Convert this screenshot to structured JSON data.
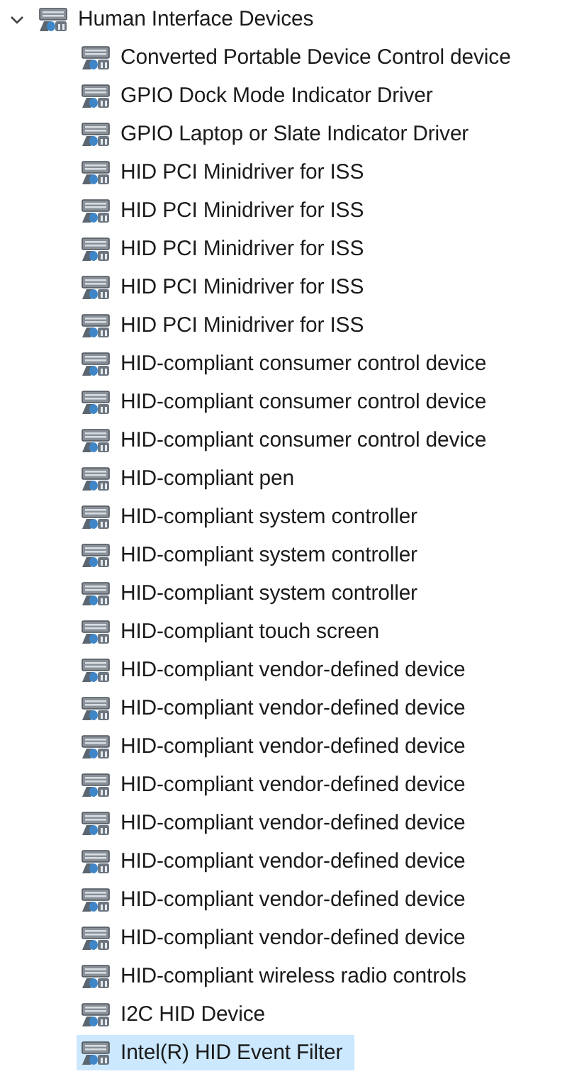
{
  "tree": {
    "label": "Human Interface Devices",
    "expanded": true,
    "children": [
      {
        "label": "Converted Portable Device Control device",
        "selected": false
      },
      {
        "label": "GPIO Dock Mode Indicator Driver",
        "selected": false
      },
      {
        "label": "GPIO Laptop or Slate Indicator Driver",
        "selected": false
      },
      {
        "label": "HID PCI Minidriver for ISS",
        "selected": false
      },
      {
        "label": "HID PCI Minidriver for ISS",
        "selected": false
      },
      {
        "label": "HID PCI Minidriver for ISS",
        "selected": false
      },
      {
        "label": "HID PCI Minidriver for ISS",
        "selected": false
      },
      {
        "label": "HID PCI Minidriver for ISS",
        "selected": false
      },
      {
        "label": "HID-compliant consumer control device",
        "selected": false
      },
      {
        "label": "HID-compliant consumer control device",
        "selected": false
      },
      {
        "label": "HID-compliant consumer control device",
        "selected": false
      },
      {
        "label": "HID-compliant pen",
        "selected": false
      },
      {
        "label": "HID-compliant system controller",
        "selected": false
      },
      {
        "label": "HID-compliant system controller",
        "selected": false
      },
      {
        "label": "HID-compliant system controller",
        "selected": false
      },
      {
        "label": "HID-compliant touch screen",
        "selected": false
      },
      {
        "label": "HID-compliant vendor-defined device",
        "selected": false
      },
      {
        "label": "HID-compliant vendor-defined device",
        "selected": false
      },
      {
        "label": "HID-compliant vendor-defined device",
        "selected": false
      },
      {
        "label": "HID-compliant vendor-defined device",
        "selected": false
      },
      {
        "label": "HID-compliant vendor-defined device",
        "selected": false
      },
      {
        "label": "HID-compliant vendor-defined device",
        "selected": false
      },
      {
        "label": "HID-compliant vendor-defined device",
        "selected": false
      },
      {
        "label": "HID-compliant vendor-defined device",
        "selected": false
      },
      {
        "label": "HID-compliant wireless radio controls",
        "selected": false
      },
      {
        "label": "I2C HID Device",
        "selected": false
      },
      {
        "label": "Intel(R) HID Event Filter",
        "selected": true
      }
    ]
  }
}
